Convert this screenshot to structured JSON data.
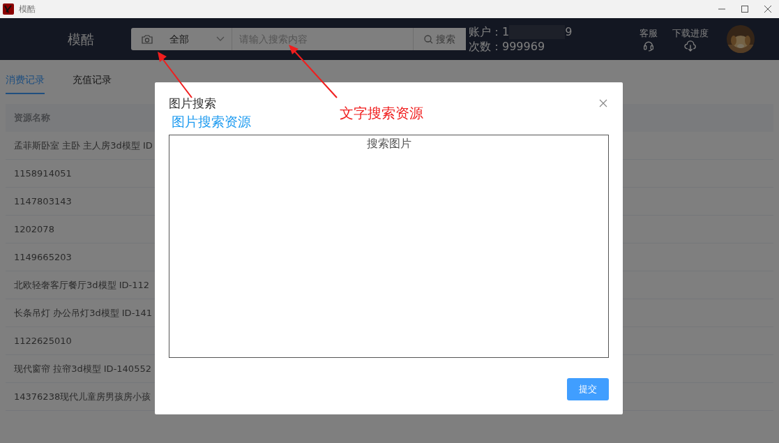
{
  "window": {
    "title": "模酷"
  },
  "header": {
    "brand": "模酷",
    "search": {
      "category": "全部",
      "placeholder": "请输入搜索内容",
      "button": "搜索"
    },
    "account": {
      "account_label": "账户：",
      "account_start": "1",
      "account_end": "9",
      "count_label": "次数：",
      "count": "999969"
    },
    "actions": [
      {
        "label": "客服",
        "kind": "headset"
      },
      {
        "label": "下载进度",
        "kind": "download"
      }
    ]
  },
  "tabs": [
    {
      "label": "消费记录",
      "selected": true
    },
    {
      "label": "充值记录",
      "selected": false
    }
  ],
  "table": {
    "columns": [
      "资源名称"
    ],
    "rows": [
      [
        "孟菲斯卧室 主卧 主人房3d模型 ID"
      ],
      [
        "1158914051"
      ],
      [
        "1147803143"
      ],
      [
        "1202078"
      ],
      [
        "1149665203"
      ],
      [
        "北欧轻奢客厅餐厅3d模型 ID-112"
      ],
      [
        "长条吊灯 办公吊灯3d模型 ID-141"
      ],
      [
        "1122625010"
      ],
      [
        "现代窗帘 拉帘3d模型 ID-140552"
      ],
      [
        "14376238现代儿童房男孩房小孩"
      ]
    ]
  },
  "dialog": {
    "title": "图片搜索",
    "note": "图片搜索资源",
    "upload_label": "搜索图片",
    "submit": "提交"
  },
  "annotations": [
    {
      "text": "文字搜索资源"
    }
  ]
}
